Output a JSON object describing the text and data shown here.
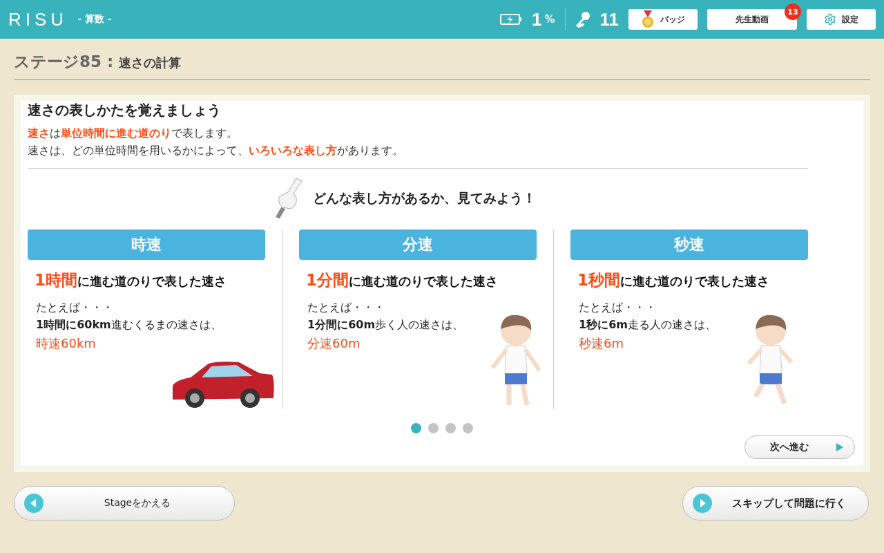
{
  "header": {
    "logo": "RISU",
    "subject": "- 算数 -",
    "battery": "1",
    "battery_unit": "%",
    "keys": "11",
    "badge_button": "バッジ",
    "video_button": "先生動画",
    "video_count": "13",
    "settings_button": "設定"
  },
  "stage": {
    "number": "ステージ85 :",
    "title": "速さの計算"
  },
  "lesson": {
    "heading": "速さの表しかたを覚えましょう",
    "lines": [
      "**速さ**は**単位時間に進む道のり**で表します。",
      "速さは、どの単位時間を用いるかによって、**いろいろな表し方**があります。"
    ],
    "prompt": "どんな表し方があるか、見てみよう！",
    "columns": [
      {
        "kind": "car",
        "title": "時速",
        "lead": "**1時間**に進む道のりで表した速さ",
        "intro": "たとえば・・・",
        "example": "**1時間に60km**進むくるまの速さは、",
        "answer": "時速60km"
      },
      {
        "kind": "walker",
        "title": "分速",
        "lead": "**1分間**に進む道のりで表した速さ",
        "intro": "たとえば・・・",
        "example": "**1分間に60m**歩く人の速さは、",
        "answer": "分速60m"
      },
      {
        "kind": "runner",
        "title": "秒速",
        "lead": "**1秒間**に進む道のりで表した速さ",
        "intro": "たとえば・・・",
        "example": "**1秒に6m**走る人の速さは、",
        "answer": "秒速6m"
      }
    ],
    "pages": [
      {
        "selected": true
      },
      {
        "selected": false
      },
      {
        "selected": false
      },
      {
        "selected": false
      }
    ],
    "next_button": "次へ進む"
  },
  "footer": {
    "back_button": "Stageをかえる",
    "skip_button": "スキップして問題に行く"
  }
}
